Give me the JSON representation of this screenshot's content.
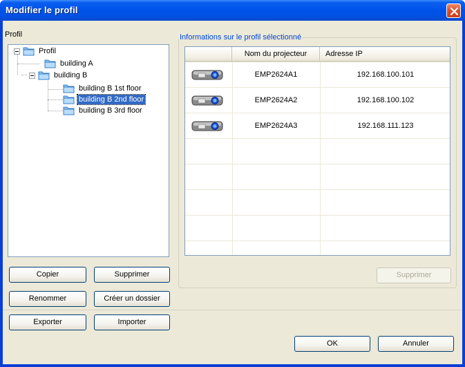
{
  "window": {
    "title": "Modifier le profil"
  },
  "profile_panel": {
    "label": "Profil",
    "tree": {
      "root": "Profil",
      "building_a": "building A",
      "building_b": "building B",
      "b1": "building B 1st floor",
      "b2": "building B 2nd floor",
      "b3": "building B 3rd floor"
    },
    "buttons": {
      "copy": "Copier",
      "delete": "Supprimer",
      "rename": "Renommer",
      "create_folder": "Créer un dossier",
      "export": "Exporter",
      "import": "Importer"
    }
  },
  "info_panel": {
    "label": "Informations sur le profil sélectionné",
    "columns": [
      "Nom du projecteur",
      "Adresse IP"
    ],
    "rows": [
      {
        "name": "EMP2624A1",
        "ip": "192.168.100.101"
      },
      {
        "name": "EMP2624A2",
        "ip": "192.168.100.102"
      },
      {
        "name": "EMP2624A3",
        "ip": "192.168.111.123"
      }
    ],
    "delete_button": "Supprimer"
  },
  "footer": {
    "ok": "OK",
    "cancel": "Annuler"
  },
  "colors": {
    "titlebar": "#0053e8",
    "selection": "#316ac5",
    "group_label": "#0046d5",
    "background": "#ece9d8"
  }
}
